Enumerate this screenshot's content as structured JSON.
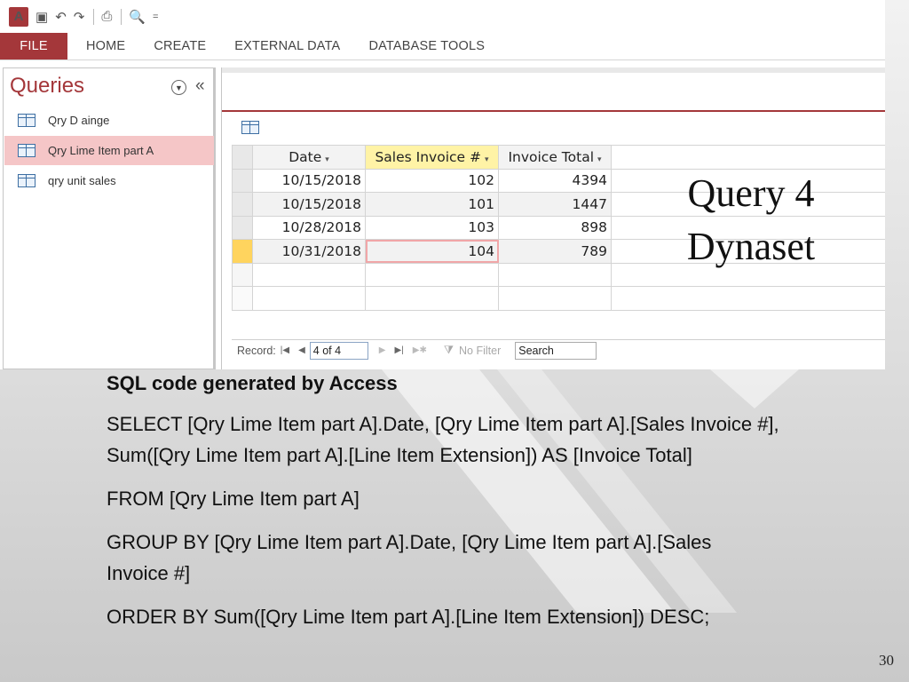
{
  "window": {
    "app_icon_label": "A",
    "qat": {
      "undo": "↶",
      "redo": "↷",
      "print": "⎙",
      "preview": "🔍",
      "customize": "="
    }
  },
  "ribbon": {
    "tabs": [
      "FILE",
      "HOME",
      "CREATE",
      "EXTERNAL DATA",
      "DATABASE TOOLS"
    ]
  },
  "nav": {
    "title": "Queries",
    "items": [
      {
        "label": "Qry D ainge",
        "selected": false
      },
      {
        "label": "Qry Lime Item part A",
        "selected": true
      },
      {
        "label": "qry unit sales",
        "selected": false
      }
    ]
  },
  "datasheet": {
    "columns": [
      "Date",
      "Sales Invoice #",
      "Invoice Total"
    ],
    "rows": [
      [
        "10/15/2018",
        "102",
        "4394"
      ],
      [
        "10/15/2018",
        "101",
        "1447"
      ],
      [
        "10/28/2018",
        "103",
        "898"
      ],
      [
        "10/31/2018",
        "104",
        "789"
      ]
    ],
    "current_row": 3,
    "record_nav": {
      "label": "Record:",
      "position": "4 of 4",
      "no_filter": "No Filter",
      "search": "Search"
    }
  },
  "callout": {
    "line1": "Query 4",
    "line2": "Dynaset"
  },
  "slide": {
    "heading": "SQL code generated by Access",
    "select": "SELECT [Qry Lime Item part A].Date, [Qry Lime Item part A].[Sales Invoice #], Sum([Qry Lime Item part A].[Line Item Extension]) AS [Invoice Total]",
    "from": "FROM [Qry Lime Item part A]",
    "group_by": "GROUP BY [Qry Lime Item part A].Date, [Qry Lime Item part A].[Sales Invoice #]",
    "order_by": "ORDER BY Sum([Qry Lime Item part A].[Line Item Extension]) DESC;",
    "page_number": "30"
  },
  "colors": {
    "access_red": "#a4373a",
    "selected_nav": "#f5c6c7",
    "header_highlight": "#fff3a6"
  }
}
